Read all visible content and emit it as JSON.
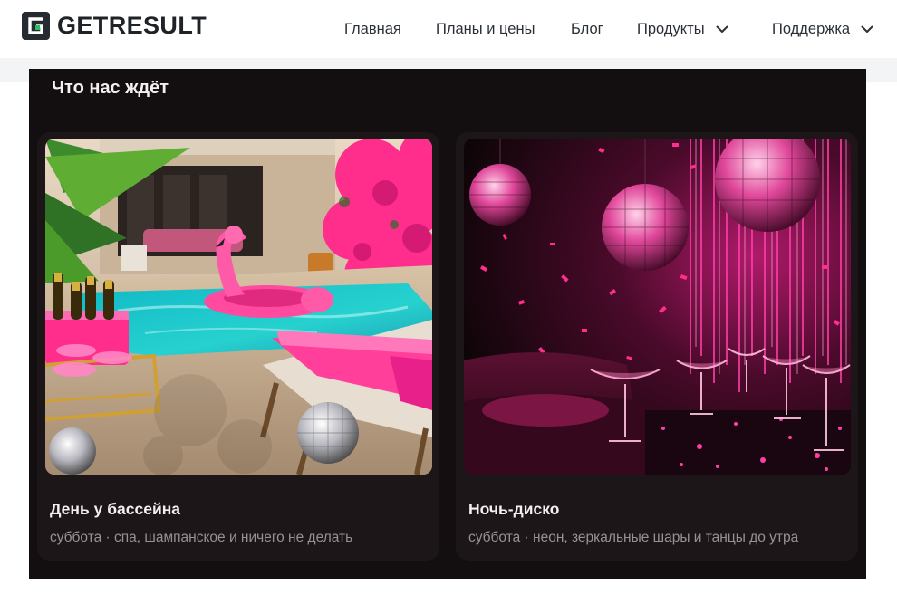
{
  "brand": {
    "name": "GETRESULT"
  },
  "nav": {
    "items": [
      {
        "label": "Главная",
        "dropdown": false
      },
      {
        "label": "Планы и цены",
        "dropdown": false
      },
      {
        "label": "Блог",
        "dropdown": false
      },
      {
        "label": "Продукты",
        "dropdown": true
      },
      {
        "label": "Поддержка",
        "dropdown": true
      }
    ]
  },
  "section": {
    "title": "Что нас ждёт",
    "cards": [
      {
        "title": "День у бассейна",
        "subtitle": "суббота · спа, шампанское и ничего не делать"
      },
      {
        "title": "Ночь-диско",
        "subtitle": "суббота · неон, зеркальные шары и танцы до утра"
      }
    ]
  },
  "colors": {
    "panel_bg": "#130e0f",
    "card_bg": "#1c1618",
    "accent_pink": "#ff2d8c",
    "logo_green": "#20c463"
  },
  "icons": {
    "logo": "getresult-logo-icon",
    "dropdown": "chevron-down-icon"
  }
}
